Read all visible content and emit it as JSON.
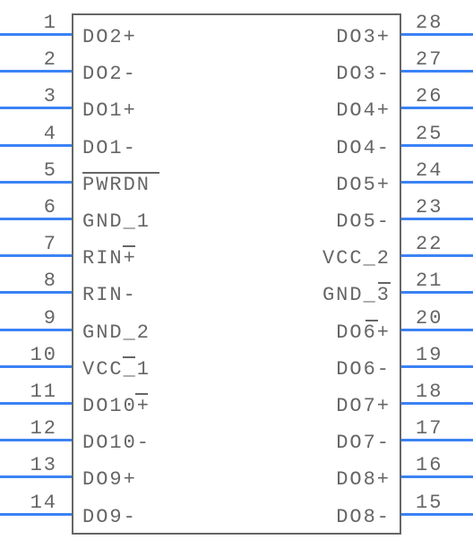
{
  "chart_data": {
    "type": "table",
    "title": "IC pinout (28-pin)",
    "pins_left": [
      {
        "num": "1",
        "label": "DO2+"
      },
      {
        "num": "2",
        "label": "DO2-"
      },
      {
        "num": "3",
        "label": "DO1+"
      },
      {
        "num": "4",
        "label": "DO1-"
      },
      {
        "num": "5",
        "label": "PWRDN",
        "overline": true
      },
      {
        "num": "6",
        "label": "GND_1"
      },
      {
        "num": "7",
        "label": "RIN+"
      },
      {
        "num": "8",
        "label": "RIN-"
      },
      {
        "num": "9",
        "label": "GND_2"
      },
      {
        "num": "10",
        "label": "VCC_1"
      },
      {
        "num": "11",
        "label": "DO10+"
      },
      {
        "num": "12",
        "label": "DO10-"
      },
      {
        "num": "13",
        "label": "DO9+"
      },
      {
        "num": "14",
        "label": "DO9-"
      }
    ],
    "pins_right": [
      {
        "num": "28",
        "label": "DO3+"
      },
      {
        "num": "27",
        "label": "DO3-"
      },
      {
        "num": "26",
        "label": "DO4+"
      },
      {
        "num": "25",
        "label": "DO4-"
      },
      {
        "num": "24",
        "label": "DO5+"
      },
      {
        "num": "23",
        "label": "DO5-"
      },
      {
        "num": "22",
        "label": "VCC_2"
      },
      {
        "num": "21",
        "label": "GND_3"
      },
      {
        "num": "20",
        "label": "DO6+"
      },
      {
        "num": "19",
        "label": "DO6-"
      },
      {
        "num": "18",
        "label": "DO7+"
      },
      {
        "num": "17",
        "label": "DO7-"
      },
      {
        "num": "16",
        "label": "DO8+"
      },
      {
        "num": "15",
        "label": "DO8-"
      }
    ]
  }
}
